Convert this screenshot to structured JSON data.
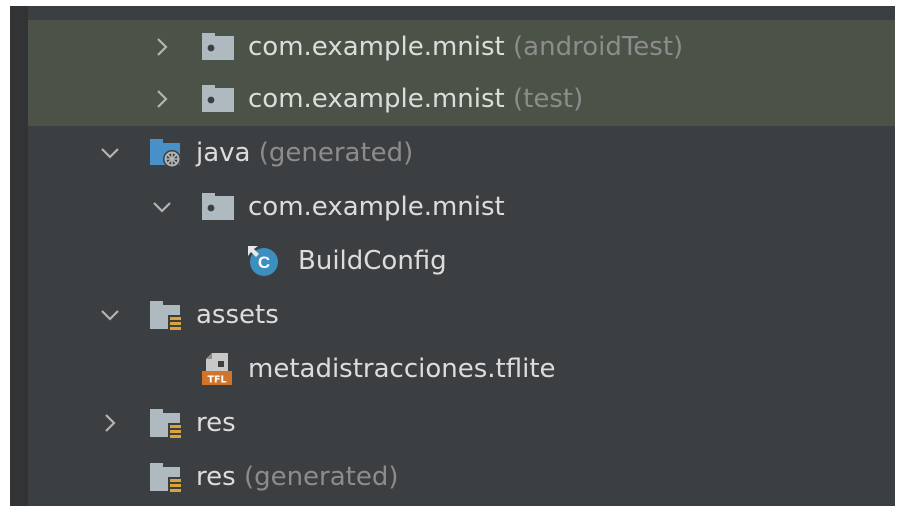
{
  "tree": {
    "nodes": [
      {
        "label": "com.example.mnist",
        "suffix": "(androidTest)",
        "icon": "package-icon",
        "chevron": "right",
        "selected": true
      },
      {
        "label": "com.example.mnist",
        "suffix": "(test)",
        "icon": "package-icon",
        "chevron": "right",
        "selected": true
      },
      {
        "label": "java",
        "suffix": "(generated)",
        "icon": "generated-source-folder-icon",
        "chevron": "down",
        "selected": false
      },
      {
        "label": "com.example.mnist",
        "suffix": "",
        "icon": "package-icon",
        "chevron": "down",
        "selected": false
      },
      {
        "label": "BuildConfig",
        "suffix": "",
        "icon": "class-icon",
        "chevron": "none",
        "selected": false
      },
      {
        "label": "assets",
        "suffix": "",
        "icon": "resource-folder-icon",
        "chevron": "down",
        "selected": false
      },
      {
        "label": "metadistracciones.tflite",
        "suffix": "",
        "icon": "tflite-file-icon",
        "chevron": "none",
        "selected": false
      },
      {
        "label": "res",
        "suffix": "",
        "icon": "resource-folder-icon",
        "chevron": "right",
        "selected": false
      },
      {
        "label": "res",
        "suffix": "(generated)",
        "icon": "resource-folder-icon",
        "chevron": "none",
        "selected": false
      }
    ]
  },
  "colors": {
    "panel_background": "#3c3f41",
    "selection": "#4b5247",
    "text": "#dcdcdc",
    "suffix_text": "#8c8c8c"
  }
}
